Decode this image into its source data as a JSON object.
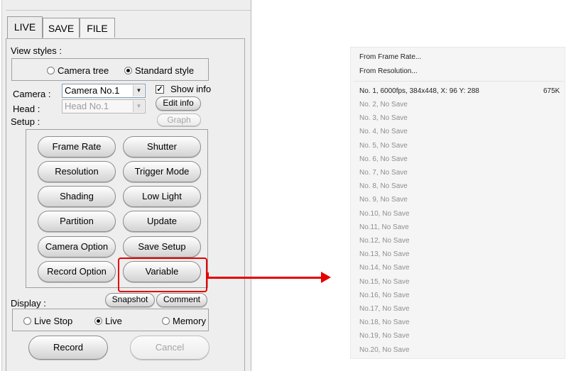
{
  "tabs": [
    "LIVE",
    "SAVE",
    "FILE"
  ],
  "view_styles": {
    "label": "View styles :",
    "options": [
      "Camera tree",
      "Standard style"
    ],
    "selected": "Standard style"
  },
  "camera": {
    "label": "Camera :",
    "value": "Camera No.1",
    "show_info_label": "Show info",
    "show_info_checked": true,
    "edit_info_label": "Edit info"
  },
  "head": {
    "label": "Head :",
    "value": "Head No.1",
    "graph_label": "Graph"
  },
  "setup": {
    "label": "Setup :",
    "buttons": [
      "Frame Rate",
      "Shutter",
      "Resolution",
      "Trigger Mode",
      "Shading",
      "Low Light",
      "Partition",
      "Update",
      "Camera Option",
      "Save Setup",
      "Record Option",
      "Variable"
    ]
  },
  "display": {
    "label": "Display :",
    "snapshot_label": "Snapshot",
    "comment_label": "Comment",
    "options": [
      "Live Stop",
      "Live",
      "Memory"
    ],
    "selected": "Live"
  },
  "record_label": "Record",
  "cancel_label": "Cancel",
  "highlight_color": "#e60000",
  "variable_menu": {
    "header_items": [
      "From Frame Rate...",
      "From Resolution..."
    ],
    "first_entry": {
      "label": "No. 1,   6000fps,   384x448,   X: 96  Y: 288",
      "size": "675K"
    },
    "entries": [
      "No. 2,  No Save",
      "No. 3,  No Save",
      "No. 4,  No Save",
      "No. 5,  No Save",
      "No. 6,  No Save",
      "No. 7,  No Save",
      "No. 8,  No Save",
      "No. 9,  No Save",
      "No.10,  No Save",
      "No.11,  No Save",
      "No.12,  No Save",
      "No.13,  No Save",
      "No.14,  No Save",
      "No.15,  No Save",
      "No.16,  No Save",
      "No.17,  No Save",
      "No.18,  No Save",
      "No.19,  No Save",
      "No.20,  No Save"
    ]
  }
}
